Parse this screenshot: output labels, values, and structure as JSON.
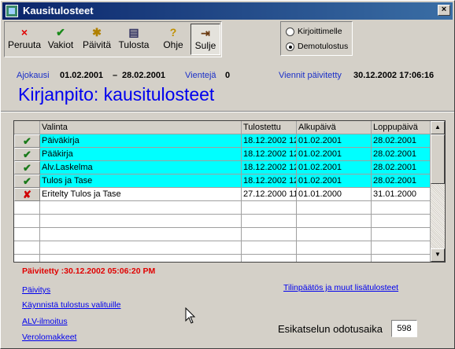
{
  "window": {
    "title": "Kausitulosteet",
    "close_glyph": "×"
  },
  "toolbar": {
    "buttons": [
      {
        "label": "Peruuta",
        "icon": "×"
      },
      {
        "label": "Vakiot",
        "icon": "✔"
      },
      {
        "label": "Päivitä",
        "icon": "✱"
      },
      {
        "label": "Tulosta",
        "icon": "▤"
      },
      {
        "label": "Ohje",
        "icon": "?"
      },
      {
        "label": "Sulje",
        "icon": "⇥"
      }
    ]
  },
  "output": {
    "options": [
      {
        "label": "Kirjoittimelle",
        "selected": false
      },
      {
        "label": "Demotulostus",
        "selected": true
      }
    ]
  },
  "info": {
    "period_label": "Ajokausi",
    "period_start": "01.02.2001",
    "period_sep": "–",
    "period_end": "28.02.2001",
    "exports_label": "Vientejä",
    "exports_count": "0",
    "updated_label": "Viennit päivitetty",
    "updated_value": "30.12.2002 17:06:16"
  },
  "page_title": "Kirjanpito: kausitulosteet",
  "table": {
    "columns": [
      "Valinta",
      "Tulostettu",
      "Alkupäivä",
      "Loppupäivä"
    ],
    "rows": [
      {
        "selected": true,
        "name": "Päiväkirja",
        "printed": "18.12.2002 12",
        "start": "01.02.2001",
        "end": "28.02.2001"
      },
      {
        "selected": true,
        "name": "Pääkirja",
        "printed": "18.12.2002 12",
        "start": "01.02.2001",
        "end": "28.02.2001"
      },
      {
        "selected": true,
        "name": "Alv.Laskelma",
        "printed": "18.12.2002 12",
        "start": "01.02.2001",
        "end": "28.02.2001"
      },
      {
        "selected": true,
        "name": "Tulos ja Tase",
        "printed": "18.12.2002 12",
        "start": "01.02.2001",
        "end": "28.02.2001"
      },
      {
        "selected": false,
        "name": "Eritelty Tulos ja Tase",
        "printed": "27.12.2000 11",
        "start": "01.01.2000",
        "end": "31.01.2000"
      }
    ],
    "check_glyph": "✔",
    "cross_glyph": "✘",
    "scroll_up": "▲",
    "scroll_down": "▼"
  },
  "status": "Päivitetty :30.12.2002 05:06:20 PM",
  "links": {
    "update": "Päivitys",
    "start_selected": "Käynnistä tulostus valituille",
    "alv": "ALV-ilmoitus",
    "tax_forms": "Verolomakkeet",
    "financial": "Tilinpäätös ja muut lisätulosteet"
  },
  "preview": {
    "label": "Esikatselun odotusaika",
    "value": "598"
  },
  "colors": {
    "highlight": "#00ffff",
    "link": "#0000ee",
    "title_blue": "#0000ee",
    "status_red": "#e00000"
  }
}
